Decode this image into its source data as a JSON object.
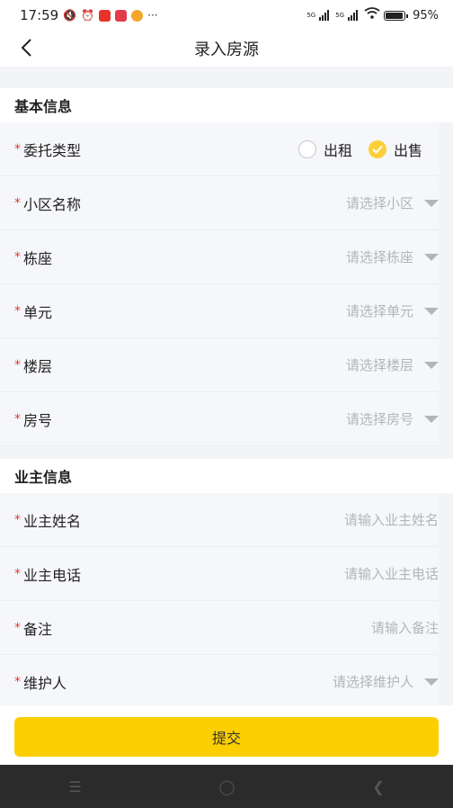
{
  "status": {
    "time": "17:59",
    "battery": "95%",
    "net1": "5G",
    "net2": "5G",
    "colors": {
      "badge1": "#e8332a",
      "badge2": "#e23c4b",
      "badge3": "#f4a62a"
    }
  },
  "nav": {
    "title": "录入房源",
    "back_icon": "chevron-left-icon"
  },
  "sections": {
    "basic": "基本信息",
    "owner": "业主信息"
  },
  "fields": {
    "type": {
      "label": "委托类型",
      "opt_rent": "出租",
      "opt_sale": "出售",
      "selected": "出售"
    },
    "community": {
      "label": "小区名称",
      "placeholder": "请选择小区"
    },
    "building": {
      "label": "栋座",
      "placeholder": "请选择栋座"
    },
    "unit": {
      "label": "单元",
      "placeholder": "请选择单元"
    },
    "floor": {
      "label": "楼层",
      "placeholder": "请选择楼层"
    },
    "room": {
      "label": "房号",
      "placeholder": "请选择房号"
    },
    "owner_name": {
      "label": "业主姓名",
      "placeholder": "请输入业主姓名"
    },
    "owner_phone": {
      "label": "业主电话",
      "placeholder": "请输入业主电话"
    },
    "remark": {
      "label": "备注",
      "placeholder": "请输入备注"
    },
    "maintainer": {
      "label": "维护人",
      "placeholder": "请选择维护人"
    }
  },
  "required_mark": "*",
  "submit_label": "提交",
  "accent": "#fccf02"
}
